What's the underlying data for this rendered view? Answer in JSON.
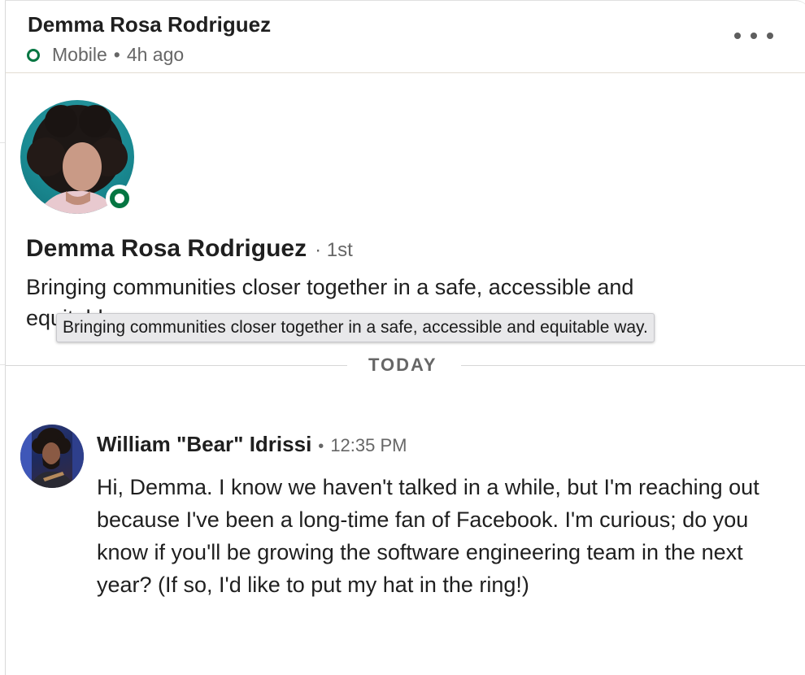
{
  "header": {
    "name": "Demma Rosa Rodriguez",
    "device": "Mobile",
    "separator": "•",
    "last_active": "4h ago",
    "more_icon": "more-horizontal-icon"
  },
  "profile": {
    "name": "Demma Rosa Rodriguez",
    "degree": "· 1st",
    "headline": "Bringing communities closer together in a safe, accessible and equitable way.",
    "tooltip": "Bringing communities closer together in a safe, accessible and equitable way.",
    "presence_color": "#057642"
  },
  "divider": {
    "label": "TODAY"
  },
  "message": {
    "sender": "William \"Bear\" Idrissi",
    "separator": "•",
    "time": "12:35 PM",
    "body": "Hi, Demma. I know we haven't talked in a while, but I'm reaching out because I've been a long-time fan of Facebook. I'm curious; do you know if you'll be growing the software engineering team in the next year? (If so, I'd like to put my hat in the ring!)"
  }
}
